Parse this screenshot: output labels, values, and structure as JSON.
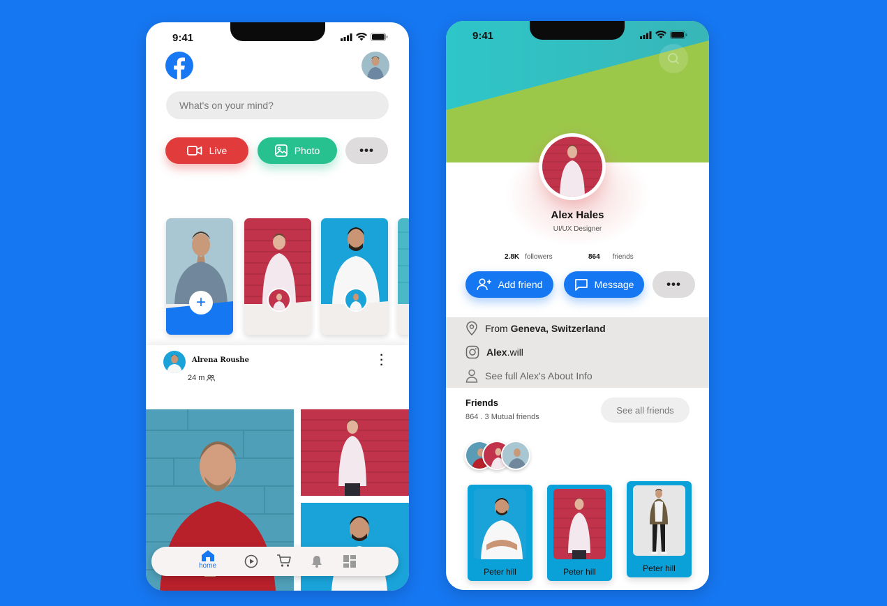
{
  "status_bar": {
    "time": "9:41"
  },
  "feed": {
    "search_placeholder": "What's on your mind?",
    "buttons": {
      "live": "Live",
      "photo": "Photo",
      "more": "•••"
    },
    "stories": [
      {
        "type": "create"
      },
      {
        "type": "friend"
      },
      {
        "type": "friend"
      },
      {
        "type": "friend"
      }
    ],
    "post": {
      "author": "Alrena Roushe",
      "time": "24 m"
    },
    "nav": {
      "home": "home"
    }
  },
  "profile": {
    "name": "Alex Hales",
    "role": "UI/UX Designer",
    "followers_count": "2.8K",
    "followers_label": "followers",
    "friends_count": "864",
    "friends_label": "friends",
    "buttons": {
      "add_friend": "Add friend",
      "message": "Message",
      "more": "•••"
    },
    "about": {
      "from_prefix": "From ",
      "from_place": "Geneva, Switzerland",
      "insta_bold": "Alex",
      "insta_rest": ".will",
      "full_info": "See full Alex's About Info"
    },
    "friends": {
      "title": "Friends",
      "subtitle": "864 . 3 Mutual friends",
      "see_all": "See all friends",
      "cards": [
        {
          "name": "Peter  hill"
        },
        {
          "name": "Peter  hill"
        },
        {
          "name": "Peter  hill"
        }
      ]
    }
  },
  "colors": {
    "accent": "#1677f2",
    "live": "#e23b3b",
    "photo": "#27c08f",
    "cover_teal": "#2bbfc9",
    "cover_green": "#9cc84a",
    "card_blue": "#0aa0d8"
  }
}
